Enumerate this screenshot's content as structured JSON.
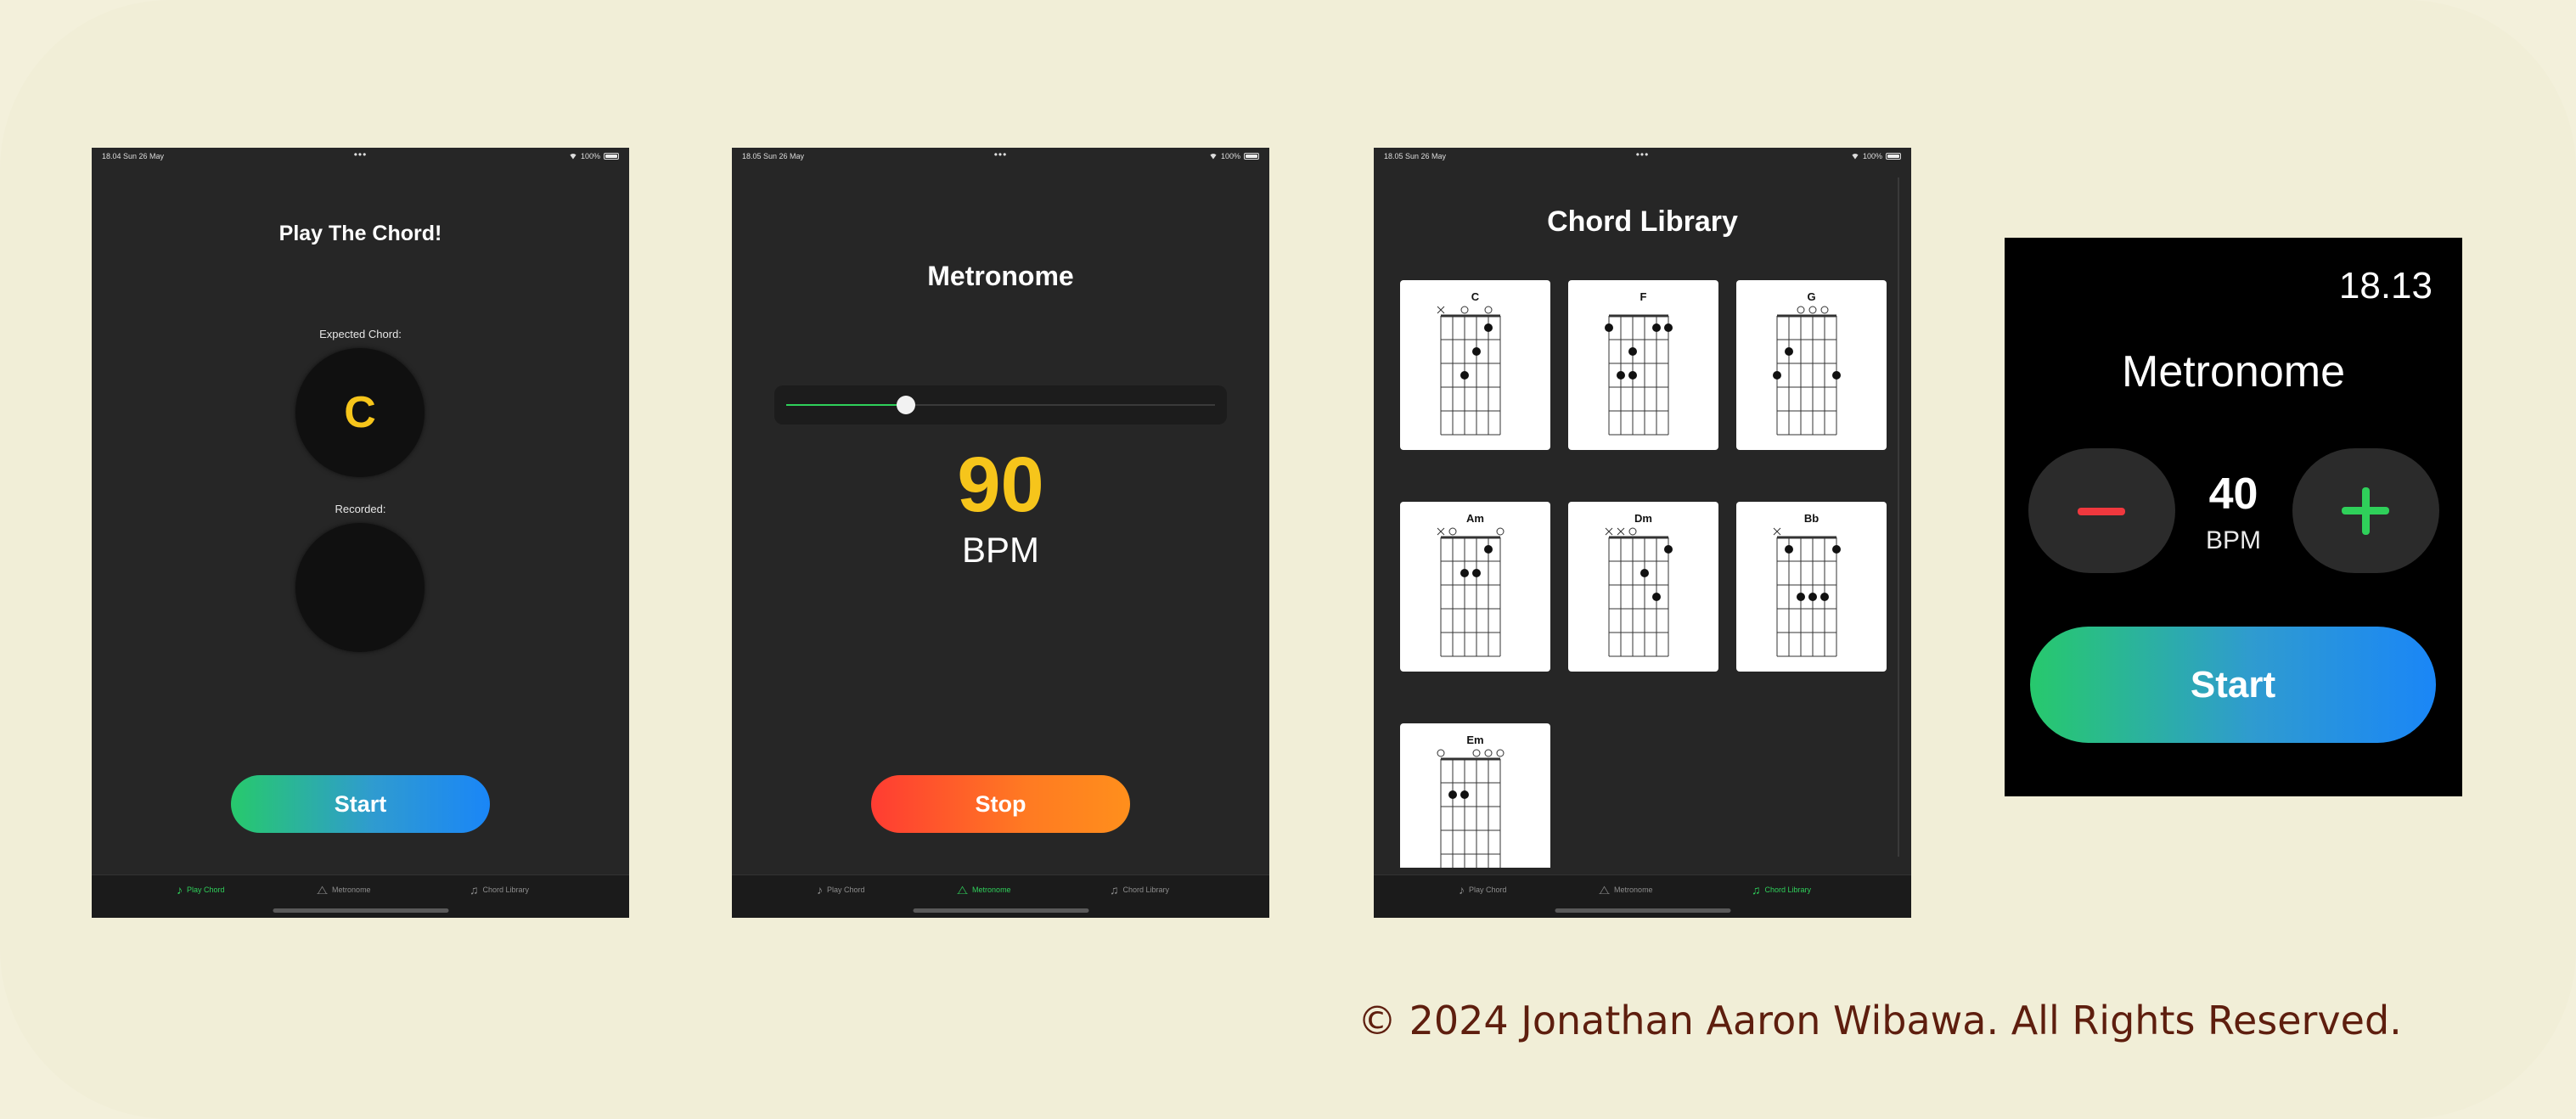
{
  "screens": [
    {
      "status": {
        "time": "18.04 Sun 26 May",
        "dots": "•••",
        "battery": "100%"
      },
      "title": "Play The Chord!",
      "expected_label": "Expected Chord:",
      "expected_chord": "C",
      "recorded_label": "Recorded:",
      "button": "Start"
    },
    {
      "status": {
        "time": "18.05 Sun 26 May",
        "dots": "•••",
        "battery": "100%"
      },
      "title": "Metronome",
      "slider_value_fraction": 0.28,
      "bpm": "90",
      "bpm_label": "BPM",
      "button": "Stop"
    },
    {
      "status": {
        "time": "18.05 Sun 26 May",
        "dots": "•••",
        "battery": "100%"
      },
      "title": "Chord Library",
      "chords": [
        "C",
        "F",
        "G",
        "Am",
        "Dm",
        "Bb",
        "Em"
      ]
    }
  ],
  "tabs": [
    "Play Chord",
    "Metronome",
    "Chord Library"
  ],
  "tab_icons": [
    "note-icon",
    "metronome-icon",
    "notes-icon"
  ],
  "watch": {
    "time": "18.13",
    "title": "Metronome",
    "bpm": "40",
    "bpm_label": "BPM",
    "button": "Start"
  },
  "colors": {
    "accent_green": "#2fd05a",
    "bpm_yellow": "#f6c51b",
    "minus_red": "#f0383e",
    "copyright_brown": "#5e1e0e"
  },
  "copyright": "© 2024 Jonathan Aaron Wibawa. All Rights Reserved."
}
